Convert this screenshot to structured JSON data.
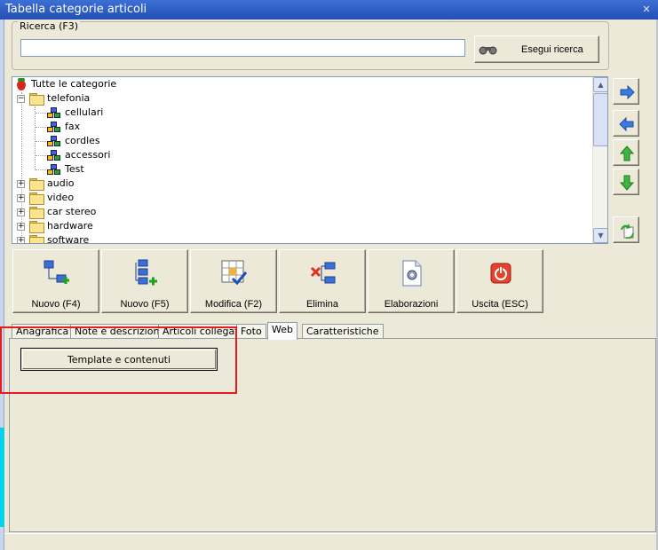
{
  "window": {
    "title": "Tabella categorie articoli",
    "close_glyph": "✕"
  },
  "search": {
    "group_label": "Ricerca (F3)",
    "input_value": "",
    "button_label": "Esegui ricerca",
    "button_icon": "binoculars-icon"
  },
  "tree": {
    "root": "Tutte le categorie",
    "expanded": "telefonia",
    "children": [
      "cellulari",
      "fax",
      "cordles",
      "accessori",
      "Test"
    ],
    "collapsed": [
      "audio",
      "video",
      "car stereo",
      "hardware",
      "software"
    ]
  },
  "side_buttons": [
    "move-right",
    "move-left",
    "move-up",
    "move-down",
    "refresh"
  ],
  "toolbar": {
    "new_f4": "Nuovo (F4)",
    "new_f5": "Nuovo (F5)",
    "edit": "Modifica (F2)",
    "delete": "Elimina",
    "process": "Elaborazioni",
    "exit": "Uscita (ESC)"
  },
  "tabs": [
    "Anagrafica",
    "Note e descrizioni",
    "Articoli collegati",
    "Foto",
    "Web",
    "Caratteristiche"
  ],
  "active_tab": "Web",
  "panel": {
    "button_label": "Template e contenuti"
  },
  "colors": {
    "highlight_box": "#e81c1c",
    "titlebar": "#2350b3"
  }
}
